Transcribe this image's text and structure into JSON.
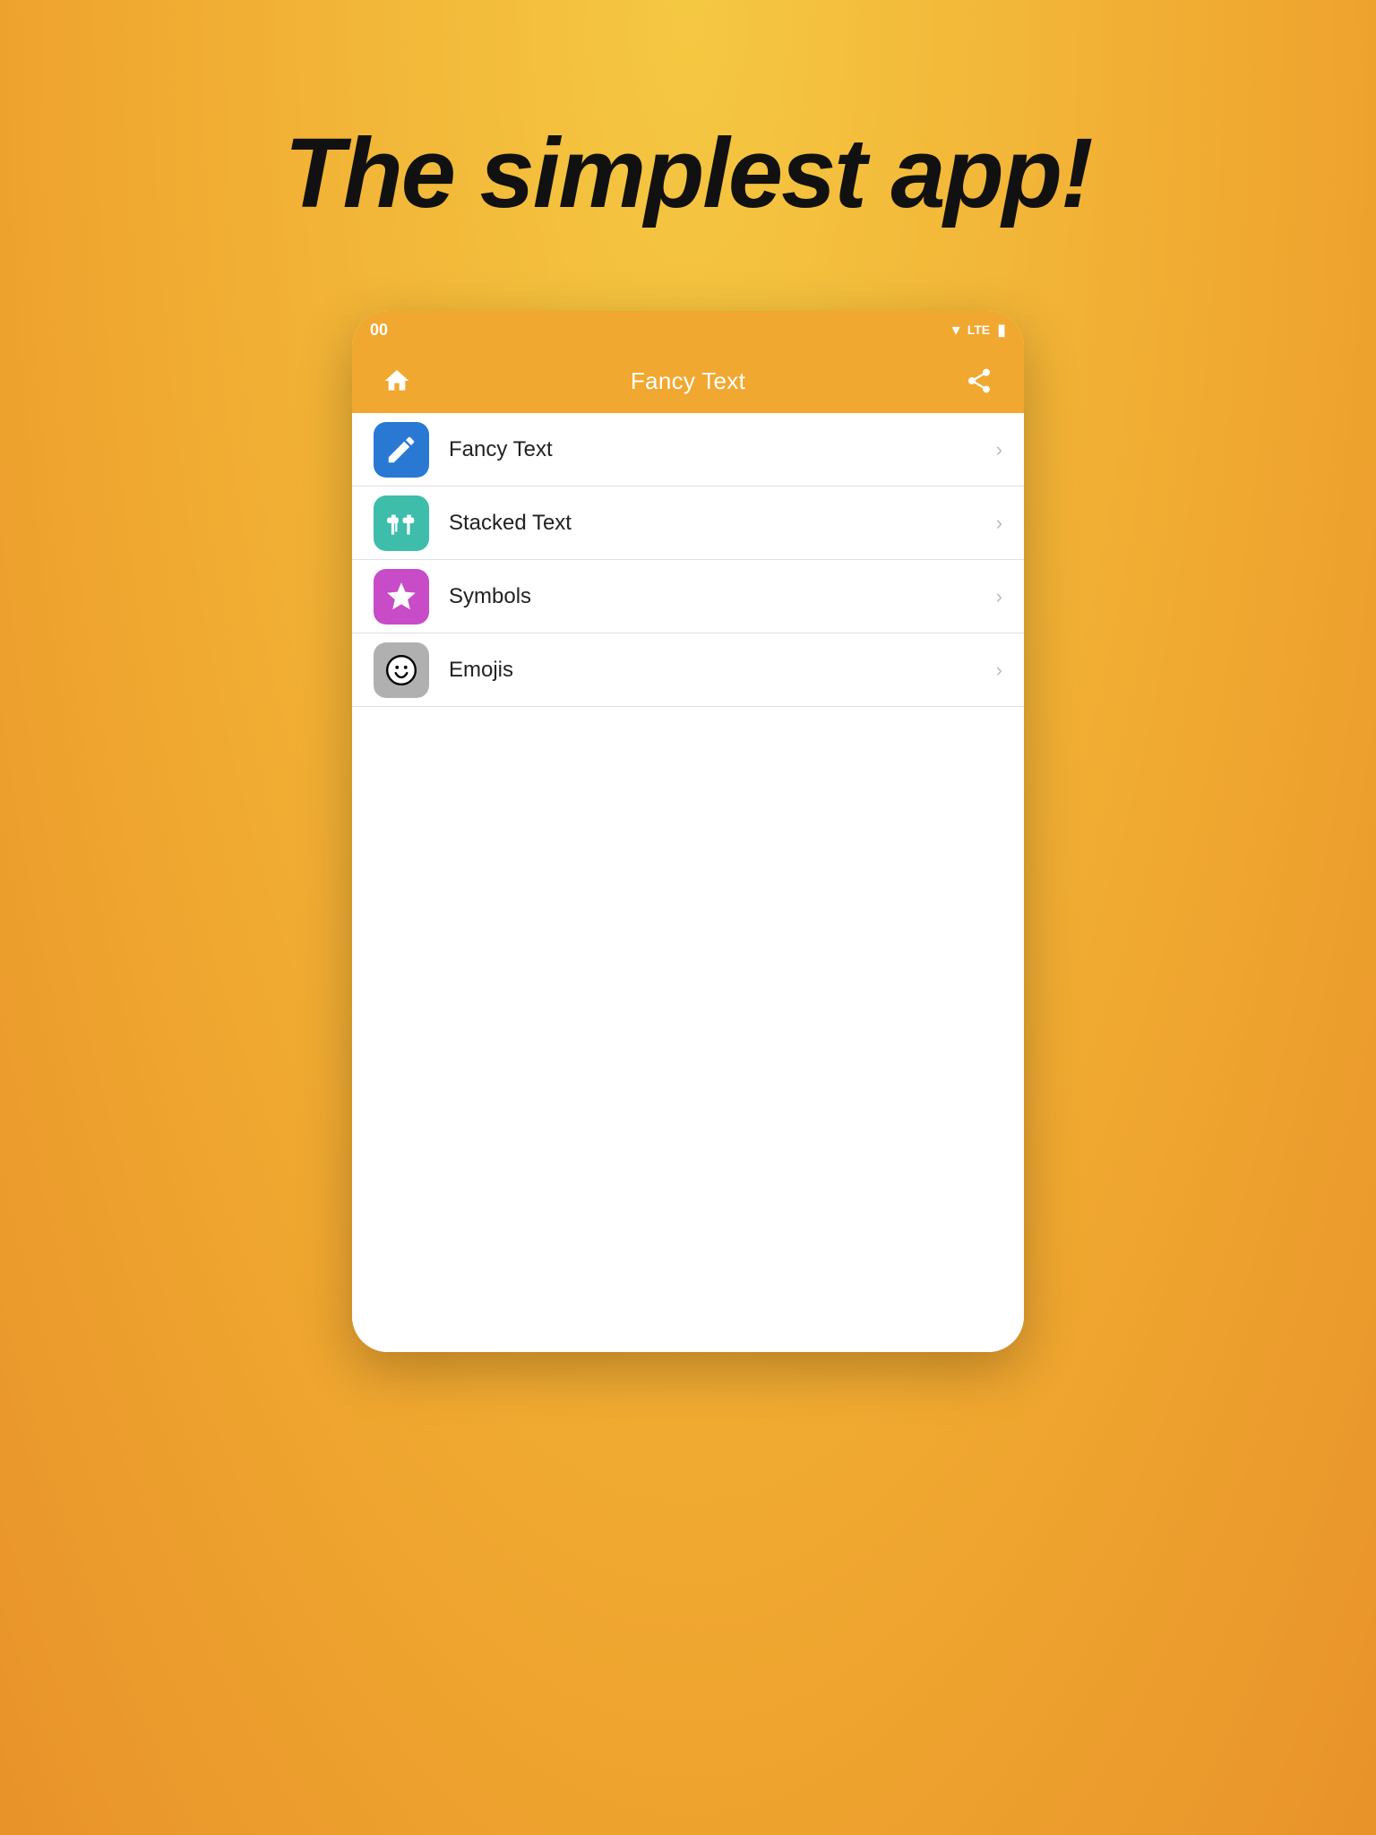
{
  "headline": "The simplest app!",
  "status_bar": {
    "time": "00",
    "lte": "LTE",
    "wifi_icon": "▼",
    "battery": "▮"
  },
  "toolbar": {
    "title": "Fancy Text",
    "home_icon": "home",
    "share_icon": "share"
  },
  "menu_items": [
    {
      "id": "fancy-text",
      "label": "Fancy Text",
      "icon_color": "blue",
      "icon_type": "pencil"
    },
    {
      "id": "stacked-text",
      "label": "Stacked Text",
      "icon_color": "teal",
      "icon_type": "text-cursor"
    },
    {
      "id": "symbols",
      "label": "Symbols",
      "icon_color": "purple",
      "icon_type": "star"
    },
    {
      "id": "emojis",
      "label": "Emojis",
      "icon_color": "gray",
      "icon_type": "smile"
    }
  ],
  "chevron_char": "›"
}
